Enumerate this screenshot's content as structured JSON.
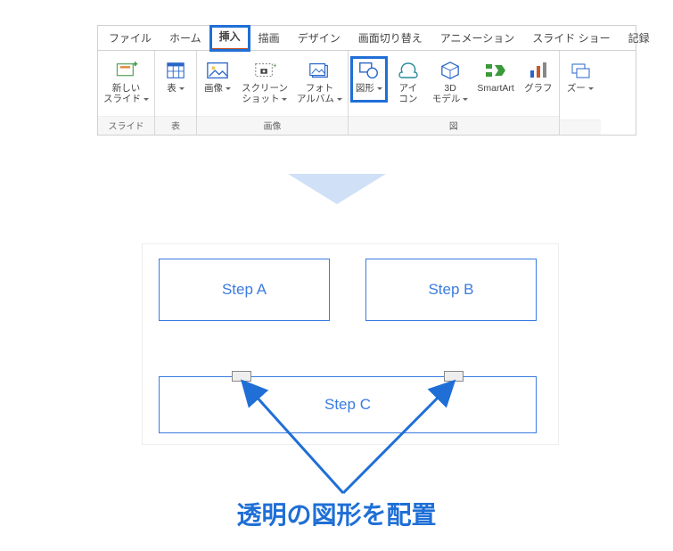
{
  "tabs": {
    "file": "ファイル",
    "home": "ホーム",
    "insert": "挿入",
    "draw": "描画",
    "design": "デザイン",
    "transition": "画面切り替え",
    "animation": "アニメーション",
    "slideshow": "スライド ショー",
    "record": "記録"
  },
  "groups": {
    "slides": {
      "label": "スライド",
      "newslide": "新しい\nスライド"
    },
    "tables": {
      "label": "表",
      "table": "表"
    },
    "images": {
      "label": "画像",
      "picture": "画像",
      "screenshot": "スクリーン\nショット",
      "photoalbum": "フォト\nアルバム"
    },
    "illust": {
      "label": "図",
      "shapes": "図形",
      "icons": "アイ\nコン",
      "model3d": "3D\nモデル",
      "smartart": "SmartArt",
      "chart": "グラフ"
    },
    "zoom": {
      "zoom": "ズー"
    }
  },
  "diagram": {
    "stepA": "Step A",
    "stepB": "Step B",
    "stepC": "Step C"
  },
  "caption": "透明の図形を配置",
  "colors": {
    "highlight": "#1f6fd6",
    "accent": "#3a7be0",
    "arrowfill": "#cfe0f7"
  }
}
